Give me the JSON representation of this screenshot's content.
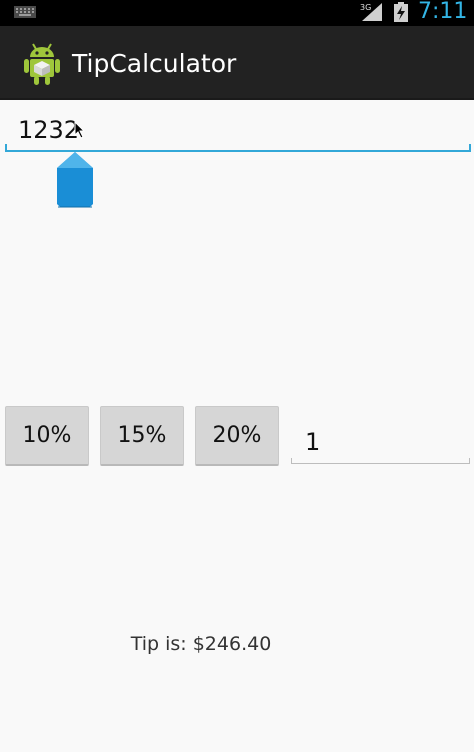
{
  "status_bar": {
    "network": "3G",
    "time": "7:11"
  },
  "action_bar": {
    "title": "TipCalculator",
    "icon": "android-icon"
  },
  "bill_amount": {
    "value": "1232"
  },
  "tip_buttons": [
    {
      "label": "10%"
    },
    {
      "label": "15%"
    },
    {
      "label": "20%"
    }
  ],
  "people": {
    "value": "1"
  },
  "result": {
    "text": "Tip is: $246.40"
  },
  "colors": {
    "accent": "#33b5e5",
    "action_bar": "#222222",
    "background": "#f9f9f9",
    "button": "#d6d6d6"
  }
}
